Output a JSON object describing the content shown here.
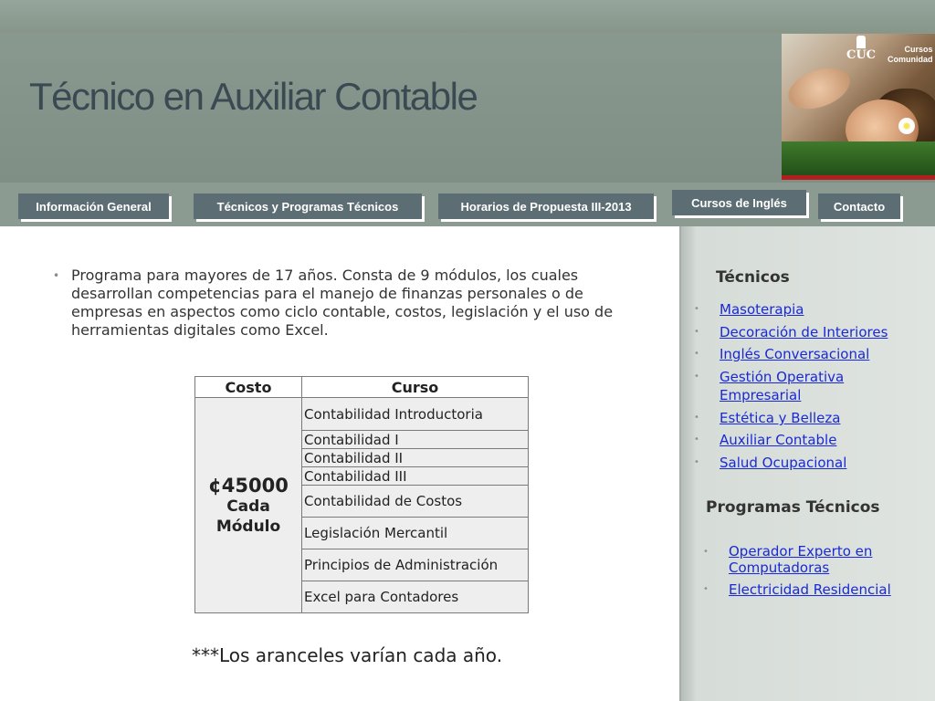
{
  "header": {
    "title": "Técnico en Auxiliar Contable",
    "logo_text": "CUC",
    "brand_line1": "Cursos",
    "brand_line2": "Comunidad"
  },
  "nav": {
    "tabs": [
      {
        "label": "Información General"
      },
      {
        "label": "Técnicos y Programas Técnicos"
      },
      {
        "label": "Horarios de Propuesta III-2013"
      },
      {
        "label": "Cursos de Inglés"
      },
      {
        "label": "Contacto"
      }
    ]
  },
  "main": {
    "description": "Programa para mayores de 17 años. Consta de 9 módulos, los cuales desarrollan competencias para el manejo de finanzas personales o de empresas en aspectos como ciclo contable, costos, legislación y el uso de herramientas digitales como Excel.",
    "table": {
      "headers": [
        "Costo",
        "Curso"
      ],
      "price": "¢45000",
      "price_unit_line1": "Cada",
      "price_unit_line2": "Módulo",
      "courses": [
        "Contabilidad Introductoria",
        "Contabilidad I",
        "Contabilidad II",
        "Contabilidad III",
        "Contabilidad de Costos",
        "Legislación Mercantil",
        "Principios de Administración",
        "Excel para Contadores"
      ]
    },
    "note": "***Los aranceles varían cada año."
  },
  "sidebar": {
    "tecnicos_title": "Técnicos",
    "tecnicos": [
      "Masoterapia",
      "Decoración de Interiores",
      "Inglés Conversacional",
      "Gestión Operativa Empresarial",
      "Estética y Belleza",
      "Auxiliar Contable",
      "Salud Ocupacional"
    ],
    "programas_title": "Programas Técnicos",
    "programas": [
      "Operador Experto en Computadoras",
      "Electricidad Residencial"
    ]
  },
  "colors": {
    "header_bg": "#8a998f",
    "tab_bg": "#5c6d74",
    "title_color": "#3a4a52",
    "link_color": "#1a29d6",
    "sidebar_bg": "#dfe4e0"
  }
}
